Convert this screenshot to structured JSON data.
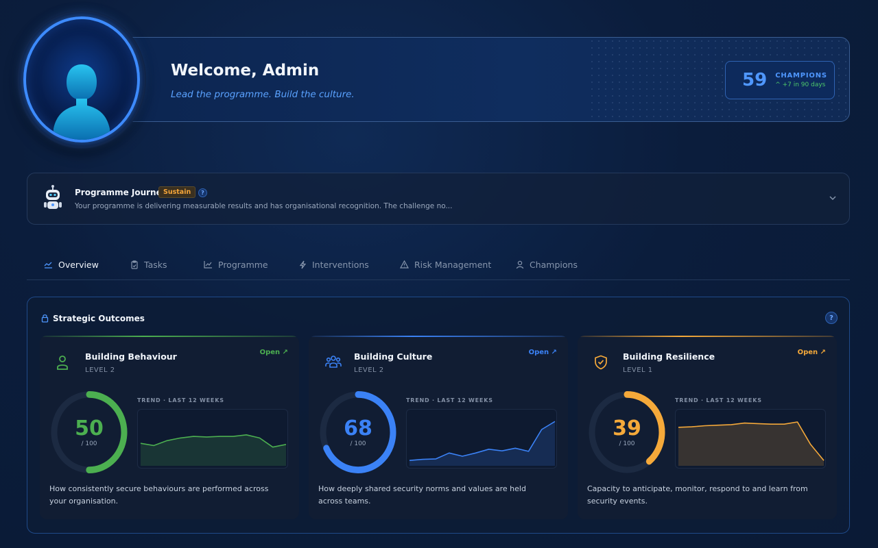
{
  "header": {
    "welcome": "Welcome, Admin",
    "subtitle": "Lead the programme. Build the culture.",
    "champions": {
      "count": "59",
      "label": "CHAMPIONS",
      "delta": "+7 in 90 days"
    }
  },
  "journey": {
    "title": "Programme Journey",
    "badge": "Sustain",
    "help": "?",
    "description": "Your programme is delivering measurable results and has organisational recognition. The challenge no..."
  },
  "tabs": [
    {
      "label": "Overview",
      "icon": "trend-icon",
      "active": true
    },
    {
      "label": "Tasks",
      "icon": "clipboard-icon"
    },
    {
      "label": "Programme",
      "icon": "chart-icon"
    },
    {
      "label": "Interventions",
      "icon": "bolt-icon"
    },
    {
      "label": "Risk Management",
      "icon": "warning-icon"
    },
    {
      "label": "Champions",
      "icon": "user-icon"
    }
  ],
  "outcomes": {
    "title": "Strategic Outcomes",
    "help": "?",
    "trend_label": "TREND · LAST 12 WEEKS",
    "cards": [
      {
        "title": "Building Behaviour",
        "level": "LEVEL 2",
        "open": "Open ↗",
        "score": 50,
        "denominator": "/ 100",
        "color": "#4caf50",
        "icon": "person-icon",
        "description": "How consistently secure behaviours are performed across your organisation.",
        "trend": [
          42,
          38,
          47,
          52,
          55,
          54,
          55,
          55,
          58,
          52,
          35,
          40
        ]
      },
      {
        "title": "Building Culture",
        "level": "LEVEL 2",
        "open": "Open ↗",
        "score": 68,
        "denominator": "/ 100",
        "color": "#3b82f6",
        "icon": "group-icon",
        "description": "How deeply shared security norms and values are held across teams.",
        "trend": [
          10,
          12,
          13,
          24,
          18,
          24,
          31,
          28,
          33,
          27,
          68,
          83
        ]
      },
      {
        "title": "Building Resilience",
        "level": "LEVEL 1",
        "open": "Open ↗",
        "score": 39,
        "denominator": "/ 100",
        "color": "#f5a93a",
        "icon": "shield-check-icon",
        "description": "Capacity to anticipate, monitor, respond to and learn from security events.",
        "trend": [
          72,
          73,
          75,
          76,
          77,
          80,
          79,
          78,
          78,
          82,
          40,
          10
        ]
      }
    ]
  }
}
